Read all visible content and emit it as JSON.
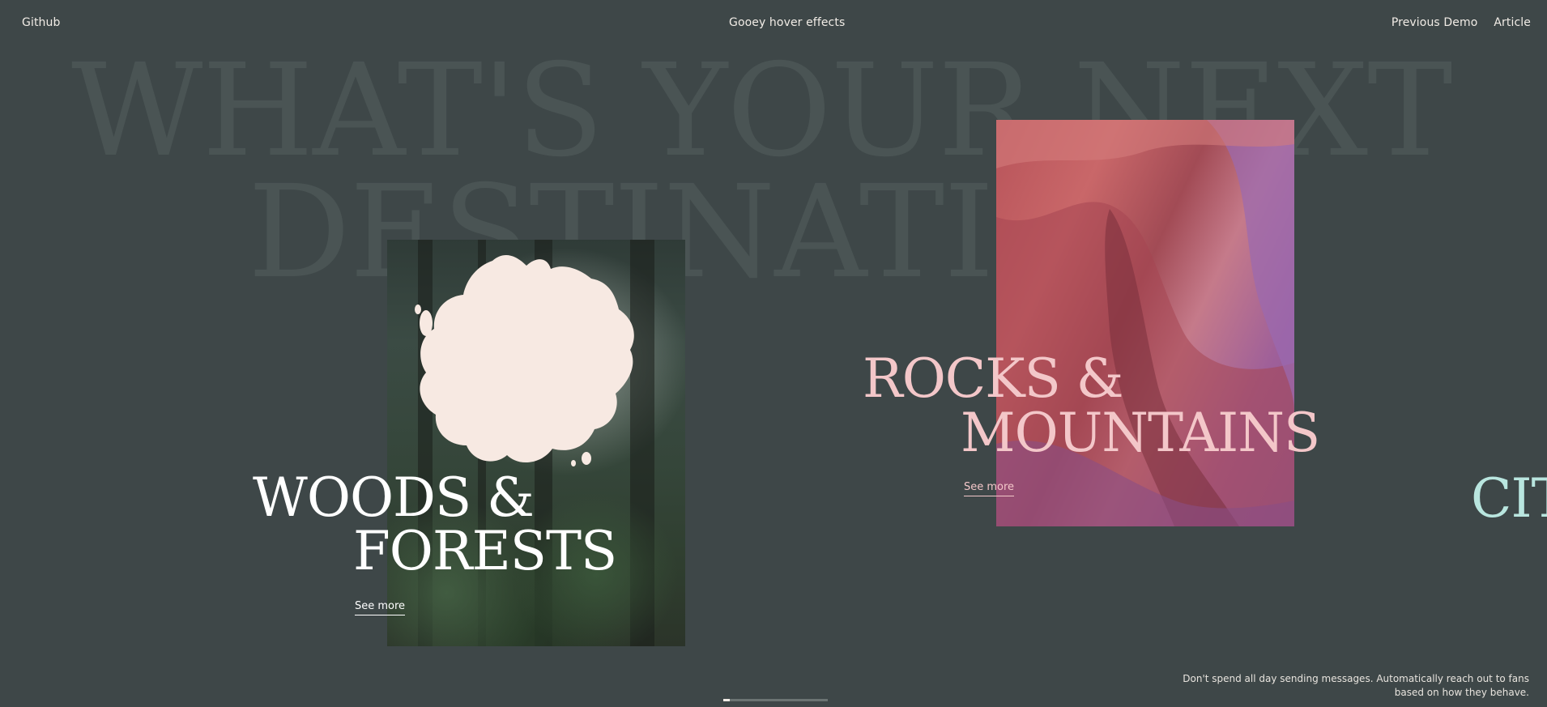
{
  "header": {
    "left_link": "Github",
    "title": "Gooey hover effects",
    "right_links": [
      "Previous Demo",
      "Article"
    ]
  },
  "background_headline": {
    "line1": "WHAT'S YOUR NEXT",
    "line2": "DESTINATION"
  },
  "cards": [
    {
      "title_line1": "WOODS &",
      "title_line2": "FORESTS",
      "cta": "See more",
      "accent": "#ffffff"
    },
    {
      "title_line1": "ROCKS &",
      "title_line2": "MOUNTAINS",
      "cta": "See more",
      "accent": "#f3c7c9"
    },
    {
      "title_line1": "CIT",
      "accent": "#b9e6df"
    }
  ],
  "promo_text": "Don't spend all day sending messages. Automatically reach out to fans based on how they behave.",
  "scroll_progress": 0.06,
  "colors": {
    "background": "#3e4748",
    "headline_ghost": "#4a5454",
    "blob": "#f7e9e2"
  }
}
